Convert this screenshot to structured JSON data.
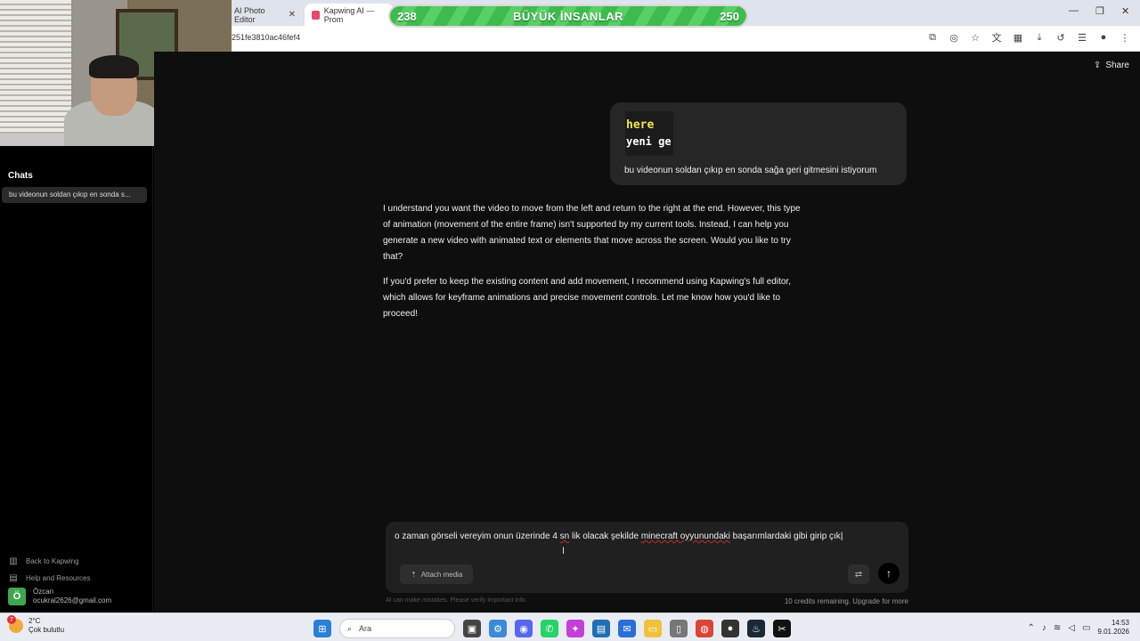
{
  "browser": {
    "tabs": [
      {
        "label": "AI Photo Editor",
        "active": false
      },
      {
        "label": "Kapwing AI — Prom",
        "active": true
      }
    ],
    "url": "251fe3810ac46fef4"
  },
  "streak_bar": {
    "left_value": "238",
    "title": "BÜYÜK İNSANLAR",
    "right_value": "250"
  },
  "sidebar": {
    "chats_heading": "Chats",
    "chat_items": [
      "bu videonun soldan çıkıp en sonda s..."
    ],
    "links": [
      {
        "label": "Back to Kapwing",
        "icon": "library-icon"
      },
      {
        "label": "Help and Resources",
        "icon": "book-icon"
      }
    ],
    "user": {
      "initial": "Ö",
      "name": "Özcan",
      "email": "ocukral2626@gmail.com"
    }
  },
  "main": {
    "share_label": "Share",
    "user_message": {
      "thumb_line1": "here",
      "thumb_line2": "yeni ge",
      "text": "bu videonun soldan çıkıp en sonda sağa geri gitmesini istiyorum"
    },
    "ai_message": [
      "I understand you want the video to move from the left and return to the right at the end. However, this type of animation (movement of the entire frame) isn't supported by my current tools. Instead, I can help you generate a new video with animated text or elements that move across the screen. Would you like to try that?",
      "If you'd prefer to keep the existing content and add movement, I recommend using Kapwing's full editor, which allows for keyframe animations and precise movement controls. Let me know how you'd like to proceed!"
    ],
    "composer": {
      "text_before": "o zaman görseli vereyim onun üzerinde 4 ",
      "text_err1": "sn",
      "text_mid1": " lik olacak şekilde ",
      "text_err2": "minecraft oyyunundaki",
      "text_after": " başarımlardaki gibi girip çık",
      "attach_label": "Attach media"
    },
    "disclaimer": "AI can make mistakes. Please verify important info.",
    "credits": "10 credits remaining. Upgrade for more"
  },
  "taskbar": {
    "weather": {
      "badge": "7",
      "temp": "2°C",
      "desc": "Çok bulutlu"
    },
    "search_placeholder": "Ara",
    "time": "14:53",
    "date": "9.01.2026"
  }
}
